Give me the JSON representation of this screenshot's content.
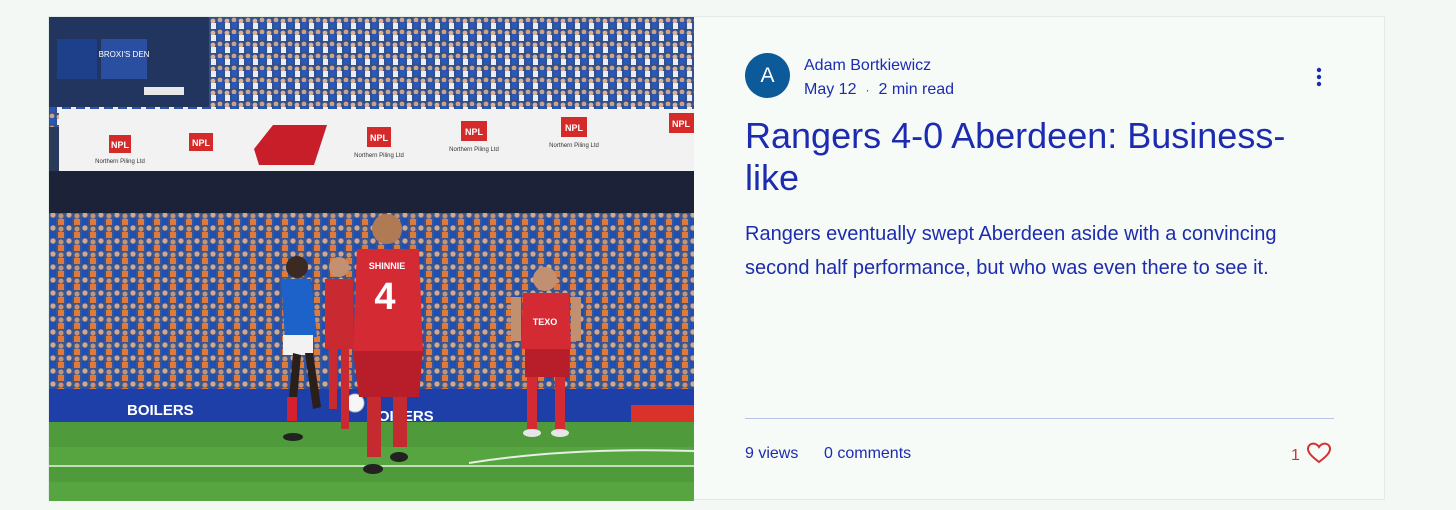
{
  "post": {
    "author": {
      "initial": "A",
      "name": "Adam Bortkiewicz"
    },
    "date": "May 12",
    "read_time": "2 min read",
    "meta_separator": "·",
    "title": "Rangers 4-0 Aberdeen: Business-like",
    "excerpt": "Rangers eventually swept Aberdeen aside with a convincing second half performance, but who was even there to see it.",
    "views": "9 views",
    "comments": "0 comments",
    "likes": "1"
  },
  "photo": {
    "ad_board_text": "NPL",
    "ad_board_subtext": "Northern Piling Ltd",
    "pitch_board_text": "BOILERS",
    "shirt_name": "SHINNIE",
    "shirt_number": "4",
    "sponsor_text": "TEXO",
    "sign_text": "BROXI'S DEN"
  },
  "colors": {
    "accent": "#1d2bb0",
    "avatar": "#0c5a9a",
    "like": "#d23232"
  },
  "icons": {
    "menu": "more-vertical-icon",
    "like": "heart-outline-icon"
  }
}
